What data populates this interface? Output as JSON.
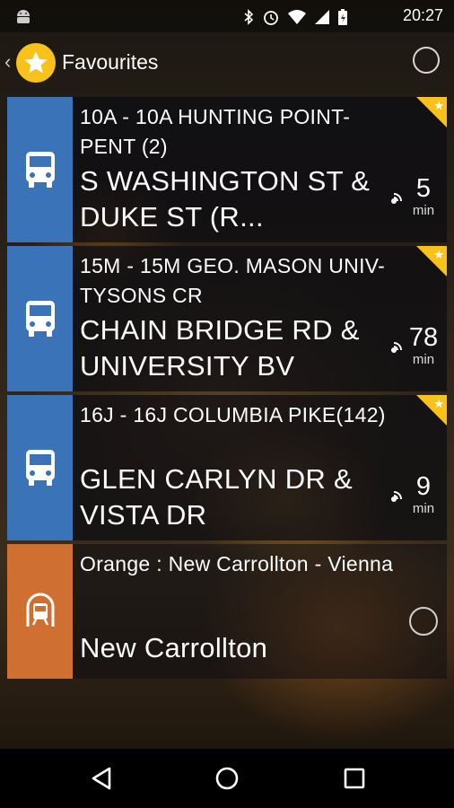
{
  "status_bar": {
    "time": "20:27",
    "icons": [
      "android-icon",
      "bluetooth-icon",
      "alarm-icon",
      "wifi-icon",
      "signal-icon",
      "battery-icon"
    ]
  },
  "app_bar": {
    "title": "Favourites",
    "icons": [
      "back-chevron-icon",
      "star-icon",
      "radio-empty-icon"
    ]
  },
  "favourites": [
    {
      "mode": "bus",
      "route": "10A - 10A HUNTING POINT-PENT  (2)",
      "stop": "S WASHINGTON ST & DUKE ST (R...",
      "minutes": "5",
      "unit": "min",
      "starred": true
    },
    {
      "mode": "bus",
      "route": "15M - 15M GEO. MASON UNIV-TYSONS CR",
      "stop": "CHAIN BRIDGE RD & UNIVERSITY BV",
      "minutes": "78",
      "unit": "min",
      "starred": true
    },
    {
      "mode": "bus",
      "route": "16J - 16J COLUMBIA PIKE(142)",
      "stop": "GLEN CARLYN DR & VISTA DR",
      "minutes": "9",
      "unit": "min",
      "starred": true
    },
    {
      "mode": "metro",
      "route": "Orange : New Carrollton - Vienna",
      "stop": "New Carrollton",
      "starred": false
    }
  ],
  "colors": {
    "bus_tile": "#3b73b9",
    "metro_tile": "#cf6f32",
    "accent_yellow": "#f8c21a"
  },
  "nav_bar": {
    "icons": [
      "back-triangle-icon",
      "home-circle-icon",
      "recents-square-icon"
    ]
  }
}
